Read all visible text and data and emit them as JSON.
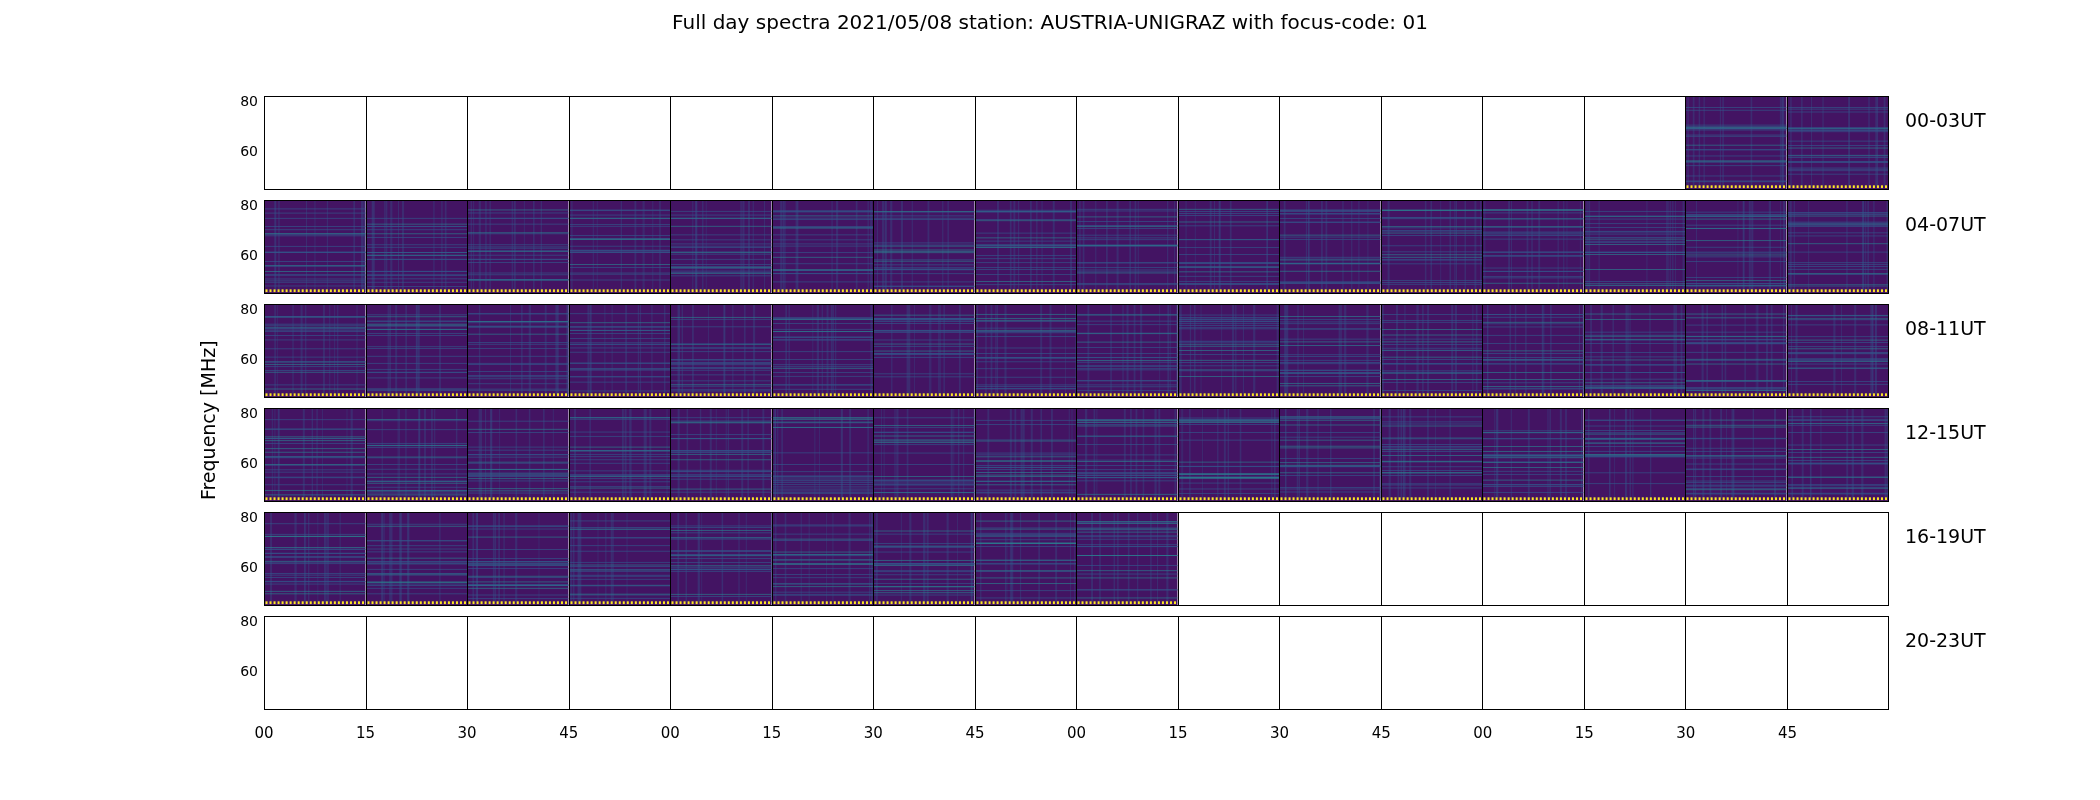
{
  "title": "Full day spectra 2021/05/08 station: AUSTRIA-UNIGRAZ with focus-code: 01",
  "ylabel": "Frequency [MHz]",
  "rows": [
    {
      "label": "00-03UT",
      "yticks": [
        "80",
        "60"
      ],
      "panels": [
        {
          "kind": "empty"
        },
        {
          "kind": "empty"
        },
        {
          "kind": "empty"
        },
        {
          "kind": "empty"
        },
        {
          "kind": "empty"
        },
        {
          "kind": "empty"
        },
        {
          "kind": "empty"
        },
        {
          "kind": "empty"
        },
        {
          "kind": "empty"
        },
        {
          "kind": "empty"
        },
        {
          "kind": "empty"
        },
        {
          "kind": "empty"
        },
        {
          "kind": "empty"
        },
        {
          "kind": "empty"
        },
        {
          "kind": "spectrum"
        },
        {
          "kind": "spectrum"
        }
      ]
    },
    {
      "label": "04-07UT",
      "yticks": [
        "80",
        "60"
      ],
      "panels": [
        {
          "kind": "spectrum"
        },
        {
          "kind": "spectrum"
        },
        {
          "kind": "spectrum"
        },
        {
          "kind": "spectrum"
        },
        {
          "kind": "spectrum"
        },
        {
          "kind": "spectrum"
        },
        {
          "kind": "spectrum"
        },
        {
          "kind": "spectrum"
        },
        {
          "kind": "spectrum"
        },
        {
          "kind": "spectrum"
        },
        {
          "kind": "spectrum"
        },
        {
          "kind": "spectrum"
        },
        {
          "kind": "spectrum"
        },
        {
          "kind": "spectrum"
        },
        {
          "kind": "spectrum"
        },
        {
          "kind": "spectrum"
        }
      ]
    },
    {
      "label": "08-11UT",
      "yticks": [
        "80",
        "60"
      ],
      "panels": [
        {
          "kind": "spectrum"
        },
        {
          "kind": "spectrum"
        },
        {
          "kind": "spectrum"
        },
        {
          "kind": "spectrum"
        },
        {
          "kind": "spectrum"
        },
        {
          "kind": "spectrum"
        },
        {
          "kind": "spectrum"
        },
        {
          "kind": "spectrum"
        },
        {
          "kind": "spectrum"
        },
        {
          "kind": "spectrum"
        },
        {
          "kind": "spectrum"
        },
        {
          "kind": "spectrum"
        },
        {
          "kind": "spectrum"
        },
        {
          "kind": "spectrum"
        },
        {
          "kind": "spectrum"
        },
        {
          "kind": "spectrum"
        }
      ]
    },
    {
      "label": "12-15UT",
      "yticks": [
        "80",
        "60"
      ],
      "panels": [
        {
          "kind": "spectrum"
        },
        {
          "kind": "spectrum"
        },
        {
          "kind": "spectrum"
        },
        {
          "kind": "spectrum"
        },
        {
          "kind": "spectrum"
        },
        {
          "kind": "spectrum"
        },
        {
          "kind": "spectrum"
        },
        {
          "kind": "spectrum"
        },
        {
          "kind": "spectrum"
        },
        {
          "kind": "spectrum"
        },
        {
          "kind": "spectrum"
        },
        {
          "kind": "spectrum"
        },
        {
          "kind": "spectrum"
        },
        {
          "kind": "spectrum"
        },
        {
          "kind": "spectrum"
        },
        {
          "kind": "spectrum"
        }
      ]
    },
    {
      "label": "16-19UT",
      "yticks": [
        "80",
        "60"
      ],
      "panels": [
        {
          "kind": "spectrum"
        },
        {
          "kind": "spectrum"
        },
        {
          "kind": "spectrum"
        },
        {
          "kind": "spectrum"
        },
        {
          "kind": "spectrum"
        },
        {
          "kind": "spectrum"
        },
        {
          "kind": "spectrum"
        },
        {
          "kind": "spectrum"
        },
        {
          "kind": "spectrum"
        },
        {
          "kind": "empty"
        },
        {
          "kind": "empty"
        },
        {
          "kind": "empty"
        },
        {
          "kind": "empty"
        },
        {
          "kind": "empty"
        },
        {
          "kind": "empty"
        },
        {
          "kind": "empty"
        }
      ]
    },
    {
      "label": "20-23UT",
      "yticks": [
        "80",
        "60"
      ],
      "panels": [
        {
          "kind": "empty"
        },
        {
          "kind": "empty"
        },
        {
          "kind": "empty"
        },
        {
          "kind": "empty"
        },
        {
          "kind": "empty"
        },
        {
          "kind": "empty"
        },
        {
          "kind": "empty"
        },
        {
          "kind": "empty"
        },
        {
          "kind": "empty"
        },
        {
          "kind": "empty"
        },
        {
          "kind": "empty"
        },
        {
          "kind": "empty"
        },
        {
          "kind": "empty"
        },
        {
          "kind": "empty"
        },
        {
          "kind": "empty"
        },
        {
          "kind": "empty"
        }
      ]
    }
  ],
  "xticks": [
    "00",
    "15",
    "30",
    "45",
    "00",
    "15",
    "30",
    "45",
    "00",
    "15",
    "30",
    "45",
    "00",
    "15",
    "30",
    "45"
  ]
}
